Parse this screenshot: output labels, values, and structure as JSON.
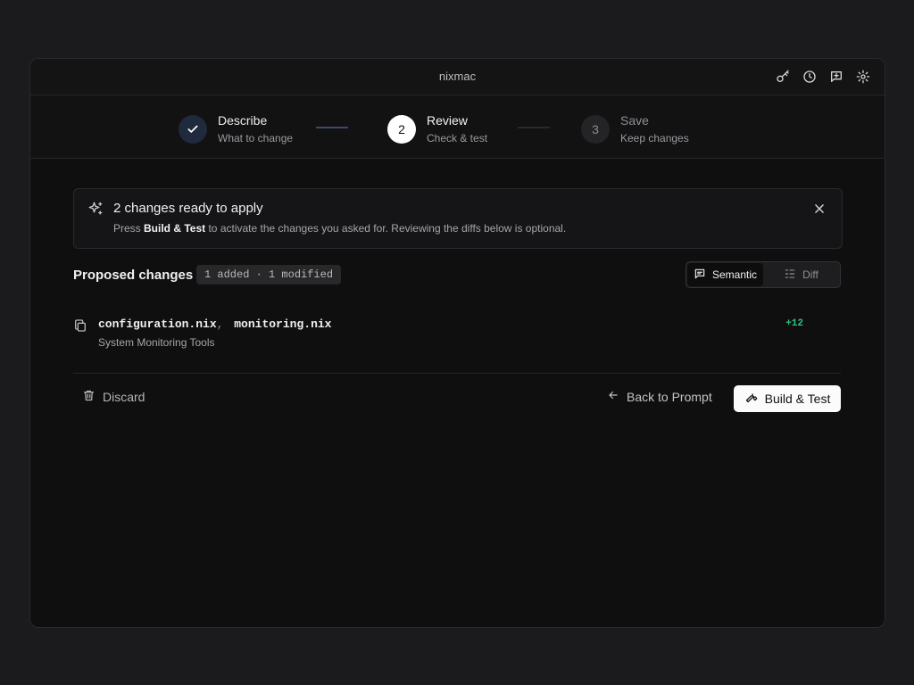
{
  "window": {
    "title": "nixmac"
  },
  "titlebar": {
    "icons": [
      "key-icon",
      "history-icon",
      "feedback-icon",
      "settings-icon"
    ]
  },
  "steps": [
    {
      "number": "",
      "label": "Describe",
      "sub": "What to change",
      "state": "done"
    },
    {
      "number": "2",
      "label": "Review",
      "sub": "Check & test",
      "state": "active"
    },
    {
      "number": "3",
      "label": "Save",
      "sub": "Keep changes",
      "state": "pending"
    }
  ],
  "banner": {
    "title": "2 changes ready to apply",
    "desc_pre": "Press ",
    "desc_bold": "Build & Test",
    "desc_post": " to activate the changes you asked for. Reviewing the diffs below is optional."
  },
  "proposed": {
    "heading": "Proposed changes",
    "badge": "1 added · 1 modified",
    "view_semantic": "Semantic",
    "view_diff": "Diff"
  },
  "changes": [
    {
      "file1": "configuration.nix",
      "sep": ",",
      "file2": "monitoring.nix",
      "category": "System Monitoring Tools",
      "added": "+12"
    }
  ],
  "actions": {
    "discard": "Discard",
    "back": "Back to Prompt",
    "build": "Build & Test"
  },
  "colors": {
    "background": "#1b1b1e",
    "window": "#0f0f10",
    "added": "#2fc27a",
    "step_done": "#1f2a3d",
    "step_active": "#ffffff"
  }
}
